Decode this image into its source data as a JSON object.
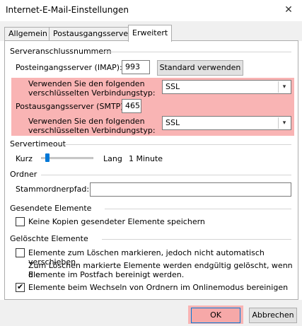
{
  "window": {
    "title": "Internet-E-Mail-Einstellungen",
    "close_glyph": "✕"
  },
  "tabs": [
    {
      "label": "Allgemein",
      "active": false
    },
    {
      "label": "Postausgangsserver",
      "active": false
    },
    {
      "label": "Erweitert",
      "active": true
    }
  ],
  "server_ports": {
    "group_title": "Serveranschlussnummern",
    "incoming_label": "Posteingangsserver (IMAP):",
    "incoming_value": "993",
    "default_button": "Standard verwenden",
    "incoming_encryption_label_1": "Verwenden Sie den folgenden",
    "incoming_encryption_label_2": "verschlüsselten Verbindungstyp:",
    "incoming_encryption_value": "SSL",
    "outgoing_label": "Postausgangsserver (SMTP):",
    "outgoing_value": "465",
    "outgoing_encryption_label_1": "Verwenden Sie den folgenden",
    "outgoing_encryption_label_2": "verschlüsselten Verbindungstyp:",
    "outgoing_encryption_value": "SSL"
  },
  "server_timeout": {
    "group_title": "Servertimeout",
    "short_label": "Kurz",
    "long_label": "Lang",
    "value_label": "1 Minute",
    "slider_fraction": 0.1
  },
  "folders": {
    "group_title": "Ordner",
    "root_label": "Stammordnerpfad:",
    "root_value": ""
  },
  "sent_items": {
    "group_title": "Gesendete Elemente",
    "no_copies_label": "Keine Kopien gesendeter Elemente speichern",
    "no_copies_checked": false
  },
  "deleted_items": {
    "group_title": "Gelöschte Elemente",
    "mark_label": "Elemente zum Löschen markieren, jedoch nicht automatisch verschieben",
    "mark_checked": false,
    "info_line_1": "Zum Löschen markierte Elemente werden endgültig gelöscht, wenn die",
    "info_line_2": "Elemente im Postfach bereinigt werden.",
    "purge_label": "Elemente beim Wechseln von Ordnern im Onlinemodus bereinigen",
    "purge_checked": true
  },
  "footer": {
    "ok_label": "OK",
    "cancel_label": "Abbrechen"
  },
  "colors": {
    "highlight": "#f9b4b4",
    "accent": "#0078d7"
  },
  "glyphs": {
    "dropdown": "▾",
    "check": "✔"
  }
}
